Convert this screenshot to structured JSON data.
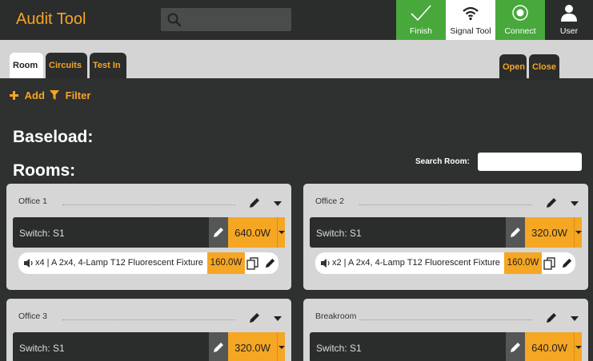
{
  "header": {
    "app_title": "Audit Tool",
    "search_icon": "search-icon",
    "buttons": [
      {
        "label": "Finish",
        "icon": "check-icon",
        "color": "#48a83c"
      },
      {
        "label": "Signal Tool",
        "icon": "wifi-icon",
        "color": "#ffffff"
      },
      {
        "label": "Connect",
        "icon": "radio-target-icon",
        "color": "#48a83c"
      },
      {
        "label": "User",
        "icon": "user-icon",
        "color": "#2b2c2c"
      }
    ]
  },
  "tabs": {
    "left": [
      "Room",
      "Circuits",
      "Test In"
    ],
    "active": "Room",
    "right": [
      "Open",
      "Close"
    ]
  },
  "actions": {
    "add_label": "Add",
    "filter_label": "Filter"
  },
  "baseload_heading": "Baseload:",
  "rooms_heading": "Rooms:",
  "search_room": {
    "label": "Search Room:",
    "value": ""
  },
  "rooms": [
    {
      "name": "Office 1",
      "switch_label": "Switch: S1",
      "switch_watts": "640.0W",
      "fixture": {
        "label": "x4 | A 2x4, 4-Lamp T12 Fluorescent Fixture",
        "watts": "160.0W"
      }
    },
    {
      "name": "Office 2",
      "switch_label": "Switch: S1",
      "switch_watts": "320.0W",
      "fixture": {
        "label": "x2 | A 2x4, 4-Lamp T12 Fluorescent Fixture",
        "watts": "160.0W"
      }
    },
    {
      "name": "Office 3",
      "switch_label": "Switch: S1",
      "switch_watts": "320.0W"
    },
    {
      "name": "Breakroom",
      "switch_label": "Switch: S1",
      "switch_watts": "640.0W"
    }
  ],
  "colors": {
    "accent": "#f5a623",
    "success": "#48a83c",
    "background": "#2f3030",
    "card": "#d6d6d6"
  }
}
